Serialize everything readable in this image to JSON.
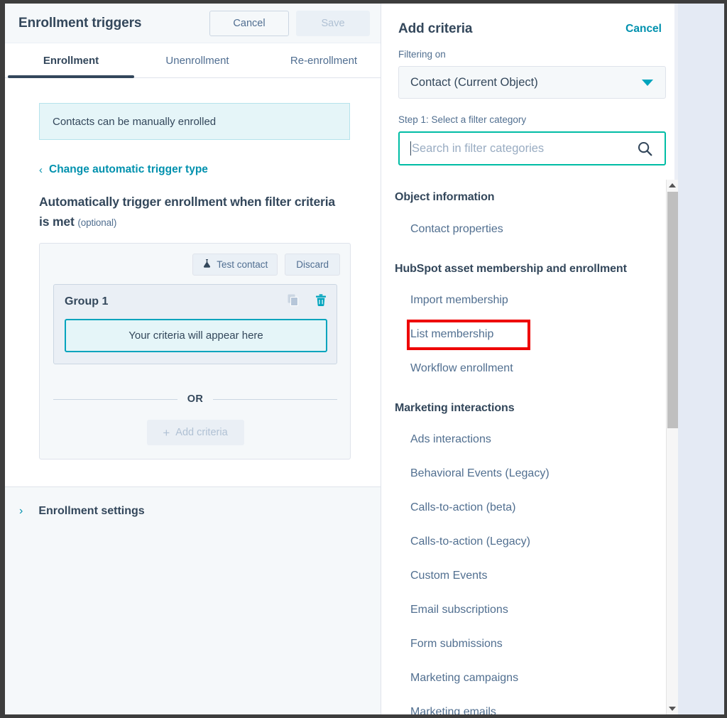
{
  "left_panel": {
    "title": "Enrollment triggers",
    "header_buttons": {
      "cancel": "Cancel",
      "save": "Save"
    },
    "tabs": [
      {
        "label": "Enrollment",
        "active": true
      },
      {
        "label": "Unenrollment",
        "active": false
      },
      {
        "label": "Re-enrollment",
        "active": false
      }
    ],
    "info_banner": "Contacts can be manually enrolled",
    "change_trigger_link": "Change automatic trigger type",
    "auto_heading": "Automatically trigger enrollment when filter criteria is met",
    "auto_heading_optional": "(optional)",
    "criteria_card": {
      "test_contact_button": "Test contact",
      "discard_button": "Discard",
      "group_title": "Group 1",
      "criteria_placeholder": "Your criteria will appear here",
      "or_label": "OR",
      "add_criteria_button": "Add criteria",
      "plus_symbol": "+"
    },
    "footer": {
      "enrollment_settings": "Enrollment settings",
      "chevron": "›"
    }
  },
  "right_panel": {
    "title": "Add criteria",
    "cancel": "Cancel",
    "filtering_on_label": "Filtering on",
    "filtering_on_value": "Contact (Current Object)",
    "step1_label": "Step 1: Select a filter category",
    "search_placeholder": "Search in filter categories",
    "groups": [
      {
        "heading": "Object information",
        "items": [
          "Contact properties"
        ]
      },
      {
        "heading": "HubSpot asset membership and enrollment",
        "items": [
          "Import membership",
          "List membership",
          "Workflow enrollment"
        ]
      },
      {
        "heading": "Marketing interactions",
        "items": [
          "Ads interactions",
          "Behavioral Events (Legacy)",
          "Calls-to-action (beta)",
          "Calls-to-action (Legacy)",
          "Custom Events",
          "Email subscriptions",
          "Form submissions",
          "Marketing campaigns",
          "Marketing emails"
        ]
      }
    ],
    "highlighted_item": "List membership"
  },
  "colors": {
    "accent_teal": "#00a4bd",
    "link_teal": "#0091ae",
    "focus_green": "#00bda5",
    "text_dark": "#33475b",
    "text_muted": "#516f90",
    "highlight_red": "#ee0000",
    "panel_bg": "#f5f8fa",
    "banner_bg": "#e5f5f8"
  }
}
